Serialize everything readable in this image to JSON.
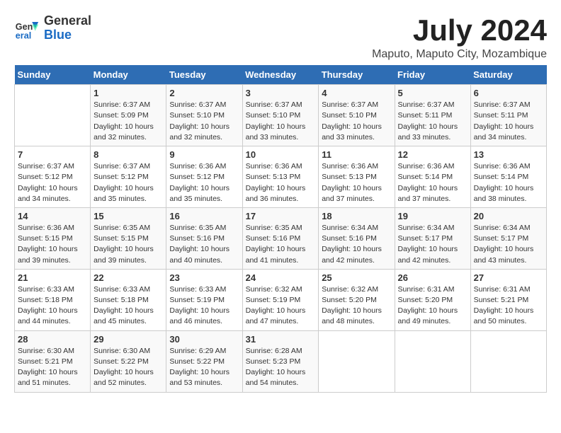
{
  "header": {
    "logo_general": "General",
    "logo_blue": "Blue",
    "month_year": "July 2024",
    "location": "Maputo, Maputo City, Mozambique"
  },
  "days_of_week": [
    "Sunday",
    "Monday",
    "Tuesday",
    "Wednesday",
    "Thursday",
    "Friday",
    "Saturday"
  ],
  "weeks": [
    [
      {
        "day": "",
        "content": ""
      },
      {
        "day": "1",
        "content": "Sunrise: 6:37 AM\nSunset: 5:09 PM\nDaylight: 10 hours\nand 32 minutes."
      },
      {
        "day": "2",
        "content": "Sunrise: 6:37 AM\nSunset: 5:10 PM\nDaylight: 10 hours\nand 32 minutes."
      },
      {
        "day": "3",
        "content": "Sunrise: 6:37 AM\nSunset: 5:10 PM\nDaylight: 10 hours\nand 33 minutes."
      },
      {
        "day": "4",
        "content": "Sunrise: 6:37 AM\nSunset: 5:10 PM\nDaylight: 10 hours\nand 33 minutes."
      },
      {
        "day": "5",
        "content": "Sunrise: 6:37 AM\nSunset: 5:11 PM\nDaylight: 10 hours\nand 33 minutes."
      },
      {
        "day": "6",
        "content": "Sunrise: 6:37 AM\nSunset: 5:11 PM\nDaylight: 10 hours\nand 34 minutes."
      }
    ],
    [
      {
        "day": "7",
        "content": "Sunrise: 6:37 AM\nSunset: 5:12 PM\nDaylight: 10 hours\nand 34 minutes."
      },
      {
        "day": "8",
        "content": "Sunrise: 6:37 AM\nSunset: 5:12 PM\nDaylight: 10 hours\nand 35 minutes."
      },
      {
        "day": "9",
        "content": "Sunrise: 6:36 AM\nSunset: 5:12 PM\nDaylight: 10 hours\nand 35 minutes."
      },
      {
        "day": "10",
        "content": "Sunrise: 6:36 AM\nSunset: 5:13 PM\nDaylight: 10 hours\nand 36 minutes."
      },
      {
        "day": "11",
        "content": "Sunrise: 6:36 AM\nSunset: 5:13 PM\nDaylight: 10 hours\nand 37 minutes."
      },
      {
        "day": "12",
        "content": "Sunrise: 6:36 AM\nSunset: 5:14 PM\nDaylight: 10 hours\nand 37 minutes."
      },
      {
        "day": "13",
        "content": "Sunrise: 6:36 AM\nSunset: 5:14 PM\nDaylight: 10 hours\nand 38 minutes."
      }
    ],
    [
      {
        "day": "14",
        "content": "Sunrise: 6:36 AM\nSunset: 5:15 PM\nDaylight: 10 hours\nand 39 minutes."
      },
      {
        "day": "15",
        "content": "Sunrise: 6:35 AM\nSunset: 5:15 PM\nDaylight: 10 hours\nand 39 minutes."
      },
      {
        "day": "16",
        "content": "Sunrise: 6:35 AM\nSunset: 5:16 PM\nDaylight: 10 hours\nand 40 minutes."
      },
      {
        "day": "17",
        "content": "Sunrise: 6:35 AM\nSunset: 5:16 PM\nDaylight: 10 hours\nand 41 minutes."
      },
      {
        "day": "18",
        "content": "Sunrise: 6:34 AM\nSunset: 5:16 PM\nDaylight: 10 hours\nand 42 minutes."
      },
      {
        "day": "19",
        "content": "Sunrise: 6:34 AM\nSunset: 5:17 PM\nDaylight: 10 hours\nand 42 minutes."
      },
      {
        "day": "20",
        "content": "Sunrise: 6:34 AM\nSunset: 5:17 PM\nDaylight: 10 hours\nand 43 minutes."
      }
    ],
    [
      {
        "day": "21",
        "content": "Sunrise: 6:33 AM\nSunset: 5:18 PM\nDaylight: 10 hours\nand 44 minutes."
      },
      {
        "day": "22",
        "content": "Sunrise: 6:33 AM\nSunset: 5:18 PM\nDaylight: 10 hours\nand 45 minutes."
      },
      {
        "day": "23",
        "content": "Sunrise: 6:33 AM\nSunset: 5:19 PM\nDaylight: 10 hours\nand 46 minutes."
      },
      {
        "day": "24",
        "content": "Sunrise: 6:32 AM\nSunset: 5:19 PM\nDaylight: 10 hours\nand 47 minutes."
      },
      {
        "day": "25",
        "content": "Sunrise: 6:32 AM\nSunset: 5:20 PM\nDaylight: 10 hours\nand 48 minutes."
      },
      {
        "day": "26",
        "content": "Sunrise: 6:31 AM\nSunset: 5:20 PM\nDaylight: 10 hours\nand 49 minutes."
      },
      {
        "day": "27",
        "content": "Sunrise: 6:31 AM\nSunset: 5:21 PM\nDaylight: 10 hours\nand 50 minutes."
      }
    ],
    [
      {
        "day": "28",
        "content": "Sunrise: 6:30 AM\nSunset: 5:21 PM\nDaylight: 10 hours\nand 51 minutes."
      },
      {
        "day": "29",
        "content": "Sunrise: 6:30 AM\nSunset: 5:22 PM\nDaylight: 10 hours\nand 52 minutes."
      },
      {
        "day": "30",
        "content": "Sunrise: 6:29 AM\nSunset: 5:22 PM\nDaylight: 10 hours\nand 53 minutes."
      },
      {
        "day": "31",
        "content": "Sunrise: 6:28 AM\nSunset: 5:23 PM\nDaylight: 10 hours\nand 54 minutes."
      },
      {
        "day": "",
        "content": ""
      },
      {
        "day": "",
        "content": ""
      },
      {
        "day": "",
        "content": ""
      }
    ]
  ]
}
